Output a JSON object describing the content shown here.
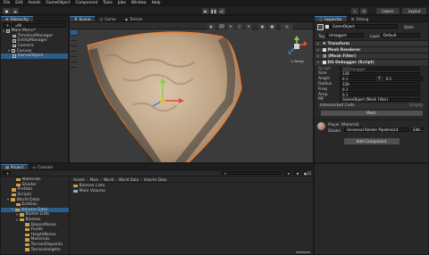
{
  "menu": [
    "File",
    "Edit",
    "Assets",
    "GameObject",
    "Component",
    "Tools",
    "Jobs",
    "Window",
    "Help"
  ],
  "toolbar": {
    "layers": "Layers",
    "layout": "Layout"
  },
  "hierarchy": {
    "tab": "Hierarchy",
    "search_placeholder": "All",
    "items": [
      {
        "label": "Main Menu*",
        "depth": 0,
        "fold": true,
        "icon": "unity-icon"
      },
      {
        "label": "TimelineManager",
        "depth": 1,
        "icon": "cube-icon"
      },
      {
        "label": "EntityManager",
        "depth": 1,
        "icon": "cube-icon"
      },
      {
        "label": "Camera",
        "depth": 1,
        "icon": "cube-icon"
      },
      {
        "label": "Canvas",
        "depth": 1,
        "fold": true,
        "icon": "cube-icon"
      },
      {
        "label": "GameObject",
        "depth": 1,
        "icon": "cube-icon",
        "selected": true
      }
    ]
  },
  "scene": {
    "tabs": [
      "Scene",
      "Game",
      "Terrain"
    ],
    "persp_label": "< Persp",
    "tools": [
      "hand-tool-icon",
      "move-tool-icon",
      "rotate-tool-icon",
      "scale-tool-icon",
      "rect-tool-icon",
      "transform-tool-icon",
      "custom-tool-icon"
    ]
  },
  "inspector": {
    "tabs": [
      "Inspector",
      "Debug"
    ],
    "object_name": "GameObject",
    "static_label": "Static",
    "tag_label": "Tag",
    "tag_value": "Untagged",
    "layer_label": "Layer",
    "layer_value": "Default",
    "components": [
      {
        "name": "Transform",
        "icon": "transform-icon"
      },
      {
        "name": "Mesh Renderer",
        "icon": "mesh-renderer-icon",
        "checked": true
      },
      {
        "name": "(Mesh Filter)",
        "icon": "mesh-filter-icon"
      },
      {
        "name": "DG Debugger (Script)",
        "icon": "script-icon",
        "checked": true
      }
    ],
    "script_field": {
      "label": "Script",
      "value": "DGDebugger"
    },
    "fields": [
      {
        "label": "Size",
        "value": "128"
      },
      {
        "label": "Angle",
        "value": "0.1",
        "extra_label": "Y",
        "extra": "0.1"
      },
      {
        "label": "Radius",
        "value": "128"
      },
      {
        "label": "Freq",
        "value": "0.1"
      },
      {
        "label": "Amp",
        "value": "0.1"
      },
      {
        "label": "MF",
        "value": "GameObject (Mesh Filter)"
      }
    ],
    "list_label": "Intersected Cells",
    "list_value": "Empty",
    "mesh_button": "Mesh",
    "material": {
      "name": "Player (Material)",
      "shader_label": "Shader",
      "shader_value": "Universal Render Pipeline/Lit",
      "edit": "Edit..."
    },
    "add_component": "Add Component"
  },
  "project": {
    "tabs": [
      "Project",
      "Console"
    ],
    "breadcrumb": [
      "Assets",
      "Main",
      "World",
      "World Data",
      "Volume Data"
    ],
    "tree": [
      {
        "label": "Materials",
        "depth": 2
      },
      {
        "label": "Shader",
        "depth": 2
      },
      {
        "label": "Prefabs",
        "depth": 1
      },
      {
        "label": "Scripts",
        "depth": 1
      },
      {
        "label": "World Data",
        "depth": 1,
        "fold": true
      },
      {
        "label": "Entities",
        "depth": 2
      },
      {
        "label": "Volume Data",
        "depth": 2,
        "fold": true,
        "selected": true
      },
      {
        "label": "Biome Lists",
        "depth": 3,
        "fold": true
      },
      {
        "label": "Biomes",
        "depth": 3,
        "fold": true
      },
      {
        "label": "DeposiNoise",
        "depth": 4
      },
      {
        "label": "Fluids",
        "depth": 4
      },
      {
        "label": "HeightNoise",
        "depth": 4
      },
      {
        "label": "Materials",
        "depth": 4
      },
      {
        "label": "TerrainDeposits",
        "depth": 4
      },
      {
        "label": "TerrainHeights",
        "depth": 4
      }
    ],
    "files": [
      "Biomes Lists",
      "Main Volume"
    ],
    "item_count": "22"
  },
  "colors": {
    "selection": "#2c5d87",
    "accent": "#3d7fc8",
    "folder": "#c9a14a",
    "outline": "#f07a2a"
  }
}
